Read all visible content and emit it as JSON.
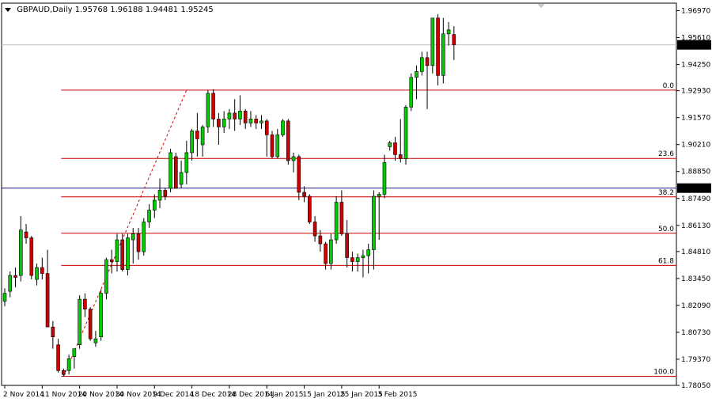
{
  "chart_data": {
    "type": "candlestick",
    "title": "GBPAUD,Daily",
    "ohlc_header": [
      "1.95768",
      "1.96188",
      "1.94481",
      "1.95245"
    ],
    "ylim": [
      1.7805,
      1.9735
    ],
    "y_ticks": [
      "1.96970",
      "1.95610",
      "1.94250",
      "1.92930",
      "1.91570",
      "1.90210",
      "1.88850",
      "1.87490",
      "1.86130",
      "1.84810",
      "1.83450",
      "1.82090",
      "1.80730",
      "1.79370",
      "1.78050"
    ],
    "x_ticks": [
      {
        "label": "2 Nov 2014",
        "index": 0
      },
      {
        "label": "11 Nov 2014",
        "index": 7
      },
      {
        "label": "20 Nov 2014",
        "index": 14
      },
      {
        "label": "30 Nov 2014",
        "index": 21
      },
      {
        "label": "9 Dec 2014",
        "index": 28
      },
      {
        "label": "18 Dec 2014",
        "index": 35
      },
      {
        "label": "28 Dec 2014",
        "index": 42
      },
      {
        "label": "6 Jan 2015",
        "index": 49
      },
      {
        "label": "15 Jan 2015",
        "index": 56
      },
      {
        "label": "25 Jan 2015",
        "index": 63
      },
      {
        "label": "3 Feb 2015",
        "index": 70
      }
    ],
    "current_price": {
      "value": 1.95245,
      "label": "1.95245"
    },
    "horizontal_line": {
      "value": 1.88012,
      "label": "1.88012",
      "color": "#1a1a8c"
    },
    "fibonacci": {
      "color": "#cc0000",
      "start_index": 11,
      "levels": [
        {
          "label": "0.0",
          "value": 1.9296
        },
        {
          "label": "23.6",
          "value": 1.8951
        },
        {
          "label": "38.2",
          "value": 1.8757
        },
        {
          "label": "50.0",
          "value": 1.8573
        },
        {
          "label": "61.8",
          "value": 1.8411
        },
        {
          "label": "100.0",
          "value": 1.7851
        }
      ],
      "trend_from": {
        "index": 11,
        "value": 1.7851
      },
      "trend_to": {
        "index": 34,
        "value": 1.9296
      }
    },
    "colors": {
      "up": "#00cc00",
      "down": "#cc0000",
      "wick": "#000000",
      "grid": "#c0c0c0",
      "label_bg": "#000000"
    },
    "candles": [
      [
        1.823,
        1.8295,
        1.8205,
        1.827
      ],
      [
        1.828,
        1.838,
        1.825,
        1.836
      ],
      [
        1.836,
        1.84,
        1.83,
        1.835
      ],
      [
        1.836,
        1.866,
        1.833,
        1.859
      ],
      [
        1.858,
        1.862,
        1.852,
        1.855
      ],
      [
        1.855,
        1.856,
        1.834,
        1.836
      ],
      [
        1.834,
        1.842,
        1.831,
        1.84
      ],
      [
        1.84,
        1.845,
        1.834,
        1.837
      ],
      [
        1.837,
        1.849,
        1.826,
        1.81
      ],
      [
        1.81,
        1.813,
        1.799,
        1.805
      ],
      [
        1.801,
        1.804,
        1.787,
        1.788
      ],
      [
        1.788,
        1.789,
        1.7851,
        1.786
      ],
      [
        1.788,
        1.796,
        1.786,
        1.794
      ],
      [
        1.795,
        1.799,
        1.789,
        1.799
      ],
      [
        1.801,
        1.826,
        1.799,
        1.824
      ],
      [
        1.824,
        1.827,
        1.815,
        1.819
      ],
      [
        1.819,
        1.82,
        1.803,
        1.804
      ],
      [
        1.802,
        1.808,
        1.8,
        1.804
      ],
      [
        1.805,
        1.829,
        1.803,
        1.827
      ],
      [
        1.827,
        1.845,
        1.824,
        1.844
      ],
      [
        1.844,
        1.849,
        1.837,
        1.843
      ],
      [
        1.843,
        1.857,
        1.838,
        1.854
      ],
      [
        1.854,
        1.857,
        1.838,
        1.839
      ],
      [
        1.839,
        1.857,
        1.836,
        1.855
      ],
      [
        1.854,
        1.86,
        1.842,
        1.857
      ],
      [
        1.857,
        1.86,
        1.844,
        1.848
      ],
      [
        1.848,
        1.865,
        1.846,
        1.863
      ],
      [
        1.863,
        1.872,
        1.86,
        1.869
      ],
      [
        1.869,
        1.877,
        1.865,
        1.874
      ],
      [
        1.874,
        1.885,
        1.87,
        1.879
      ],
      [
        1.879,
        1.88,
        1.874,
        1.876
      ],
      [
        1.88,
        1.9,
        1.878,
        1.898
      ],
      [
        1.896,
        1.898,
        1.882,
        1.88
      ],
      [
        1.882,
        1.894,
        1.88,
        1.888
      ],
      [
        1.888,
        1.904,
        1.882,
        1.898
      ],
      [
        1.898,
        1.91,
        1.894,
        1.909
      ],
      [
        1.909,
        1.918,
        1.896,
        1.905
      ],
      [
        1.902,
        1.912,
        1.896,
        1.911
      ],
      [
        1.911,
        1.9296,
        1.908,
        1.928
      ],
      [
        1.928,
        1.93,
        1.911,
        1.915
      ],
      [
        1.915,
        1.918,
        1.902,
        1.911
      ],
      [
        1.911,
        1.919,
        1.908,
        1.915
      ],
      [
        1.915,
        1.92,
        1.91,
        1.918
      ],
      [
        1.918,
        1.925,
        1.909,
        1.915
      ],
      [
        1.915,
        1.927,
        1.912,
        1.919
      ],
      [
        1.919,
        1.92,
        1.91,
        1.913
      ],
      [
        1.913,
        1.919,
        1.911,
        1.915
      ],
      [
        1.915,
        1.917,
        1.91,
        1.913
      ],
      [
        1.913,
        1.917,
        1.91,
        1.914
      ],
      [
        1.914,
        1.915,
        1.896,
        1.907
      ],
      [
        1.907,
        1.909,
        1.895,
        1.896
      ],
      [
        1.896,
        1.91,
        1.895,
        1.907
      ],
      [
        1.907,
        1.915,
        1.906,
        1.914
      ],
      [
        1.914,
        1.915,
        1.892,
        1.894
      ],
      [
        1.894,
        1.898,
        1.888,
        1.896
      ],
      [
        1.896,
        1.897,
        1.874,
        1.878
      ],
      [
        1.878,
        1.881,
        1.873,
        1.876
      ],
      [
        1.876,
        1.877,
        1.862,
        1.863
      ],
      [
        1.863,
        1.866,
        1.853,
        1.856
      ],
      [
        1.856,
        1.859,
        1.848,
        1.852
      ],
      [
        1.852,
        1.853,
        1.839,
        1.842
      ],
      [
        1.842,
        1.857,
        1.839,
        1.854
      ],
      [
        1.854,
        1.876,
        1.852,
        1.873
      ],
      [
        1.873,
        1.879,
        1.856,
        1.857
      ],
      [
        1.857,
        1.864,
        1.84,
        1.845
      ],
      [
        1.845,
        1.848,
        1.838,
        1.843
      ],
      [
        1.843,
        1.847,
        1.838,
        1.845
      ],
      [
        1.845,
        1.849,
        1.835,
        1.846
      ],
      [
        1.846,
        1.852,
        1.837,
        1.849
      ],
      [
        1.849,
        1.879,
        1.839,
        1.876
      ],
      [
        1.876,
        1.878,
        1.854,
        1.877
      ],
      [
        1.877,
        1.897,
        1.875,
        1.893
      ],
      [
        1.901,
        1.904,
        1.899,
        1.903
      ],
      [
        1.903,
        1.906,
        1.894,
        1.897
      ],
      [
        1.897,
        1.915,
        1.893,
        1.895
      ],
      [
        1.895,
        1.922,
        1.892,
        1.921
      ],
      [
        1.921,
        1.938,
        1.919,
        1.936
      ],
      [
        1.936,
        1.942,
        1.925,
        1.939
      ],
      [
        1.939,
        1.949,
        1.937,
        1.946
      ],
      [
        1.946,
        1.949,
        1.92,
        1.942
      ],
      [
        1.942,
        1.966,
        1.938,
        1.966
      ],
      [
        1.966,
        1.968,
        1.932,
        1.937
      ],
      [
        1.937,
        1.966,
        1.933,
        1.958
      ],
      [
        1.958,
        1.964,
        1.952,
        1.96
      ],
      [
        1.95768,
        1.96188,
        1.94481,
        1.95245
      ]
    ]
  }
}
